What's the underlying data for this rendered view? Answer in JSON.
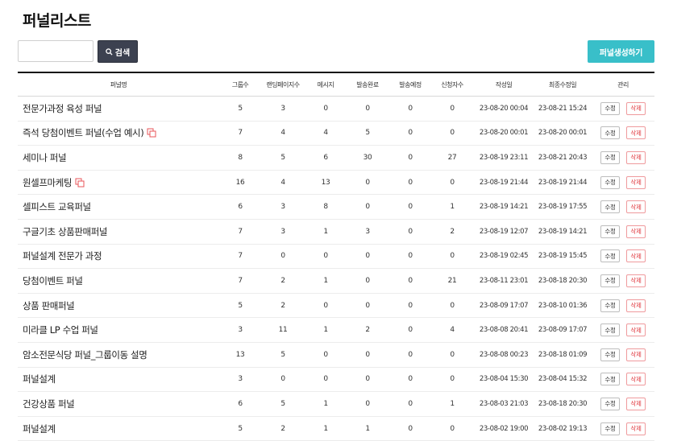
{
  "page": {
    "title": "퍼널리스트"
  },
  "search": {
    "value": "",
    "button_label": "검색"
  },
  "create_button_label": "퍼널생성하기",
  "table": {
    "headers": [
      "퍼널명",
      "그룹수",
      "랜딩페이지수",
      "메시지",
      "발송완료",
      "발송예정",
      "신청자수",
      "작성일",
      "최종수정일",
      "관리"
    ],
    "edit_label": "수정",
    "delete_label": "삭제",
    "rows": [
      {
        "name": "전문가과정 육성 퍼널",
        "copy": false,
        "groups": "5",
        "landing": "3",
        "messages": "0",
        "sent": "0",
        "scheduled": "0",
        "applicants": "0",
        "created": "23-08-20 00:04",
        "modified": "23-08-21 15:24"
      },
      {
        "name": "즉석 당첨이벤트 퍼널(수업 예시)",
        "copy": true,
        "groups": "7",
        "landing": "4",
        "messages": "4",
        "sent": "5",
        "scheduled": "0",
        "applicants": "0",
        "created": "23-08-20 00:01",
        "modified": "23-08-20 00:01"
      },
      {
        "name": "세미나 퍼널",
        "copy": false,
        "groups": "8",
        "landing": "5",
        "messages": "6",
        "sent": "30",
        "scheduled": "0",
        "applicants": "27",
        "created": "23-08-19 23:11",
        "modified": "23-08-21 20:43"
      },
      {
        "name": "원셀프마케팅",
        "copy": true,
        "groups": "16",
        "landing": "4",
        "messages": "13",
        "sent": "0",
        "scheduled": "0",
        "applicants": "0",
        "created": "23-08-19 21:44",
        "modified": "23-08-19 21:44"
      },
      {
        "name": "셀피스트 교육퍼널",
        "copy": false,
        "groups": "6",
        "landing": "3",
        "messages": "8",
        "sent": "0",
        "scheduled": "0",
        "applicants": "1",
        "created": "23-08-19 14:21",
        "modified": "23-08-19 17:55"
      },
      {
        "name": "구글기초 상품판매퍼널",
        "copy": false,
        "groups": "7",
        "landing": "3",
        "messages": "1",
        "sent": "3",
        "scheduled": "0",
        "applicants": "2",
        "created": "23-08-19 12:07",
        "modified": "23-08-19 14:21"
      },
      {
        "name": "퍼널설계 전문가 과정",
        "copy": false,
        "groups": "7",
        "landing": "0",
        "messages": "0",
        "sent": "0",
        "scheduled": "0",
        "applicants": "0",
        "created": "23-08-19 02:45",
        "modified": "23-08-19 15:45"
      },
      {
        "name": "당첨이벤트 퍼널",
        "copy": false,
        "groups": "7",
        "landing": "2",
        "messages": "1",
        "sent": "0",
        "scheduled": "0",
        "applicants": "21",
        "created": "23-08-11 23:01",
        "modified": "23-08-18 20:30"
      },
      {
        "name": "상품 판매퍼널",
        "copy": false,
        "groups": "5",
        "landing": "2",
        "messages": "0",
        "sent": "0",
        "scheduled": "0",
        "applicants": "0",
        "created": "23-08-09 17:07",
        "modified": "23-08-10 01:36"
      },
      {
        "name": "미라클 LP 수업 퍼널",
        "copy": false,
        "groups": "3",
        "landing": "11",
        "messages": "1",
        "sent": "2",
        "scheduled": "0",
        "applicants": "4",
        "created": "23-08-08 20:41",
        "modified": "23-08-09 17:07"
      },
      {
        "name": "암소전문식당 퍼널_그룹이동 설명",
        "copy": false,
        "groups": "13",
        "landing": "5",
        "messages": "0",
        "sent": "0",
        "scheduled": "0",
        "applicants": "0",
        "created": "23-08-08 00:23",
        "modified": "23-08-18 01:09"
      },
      {
        "name": "퍼널설계",
        "copy": false,
        "groups": "3",
        "landing": "0",
        "messages": "0",
        "sent": "0",
        "scheduled": "0",
        "applicants": "0",
        "created": "23-08-04 15:30",
        "modified": "23-08-04 15:32"
      },
      {
        "name": "건강상품 퍼널",
        "copy": false,
        "groups": "6",
        "landing": "5",
        "messages": "1",
        "sent": "0",
        "scheduled": "0",
        "applicants": "1",
        "created": "23-08-03 21:03",
        "modified": "23-08-18 20:30"
      },
      {
        "name": "퍼널설계",
        "copy": false,
        "groups": "5",
        "landing": "2",
        "messages": "1",
        "sent": "1",
        "scheduled": "0",
        "applicants": "0",
        "created": "23-08-02 19:00",
        "modified": "23-08-02 19:13"
      }
    ]
  },
  "icons": {
    "search": "search-icon",
    "copy": "copy-icon"
  },
  "colors": {
    "search_button": "#3c4150",
    "create_button": "#39bfc9",
    "delete": "#e0373d",
    "copy_icon": "#e8555a"
  }
}
